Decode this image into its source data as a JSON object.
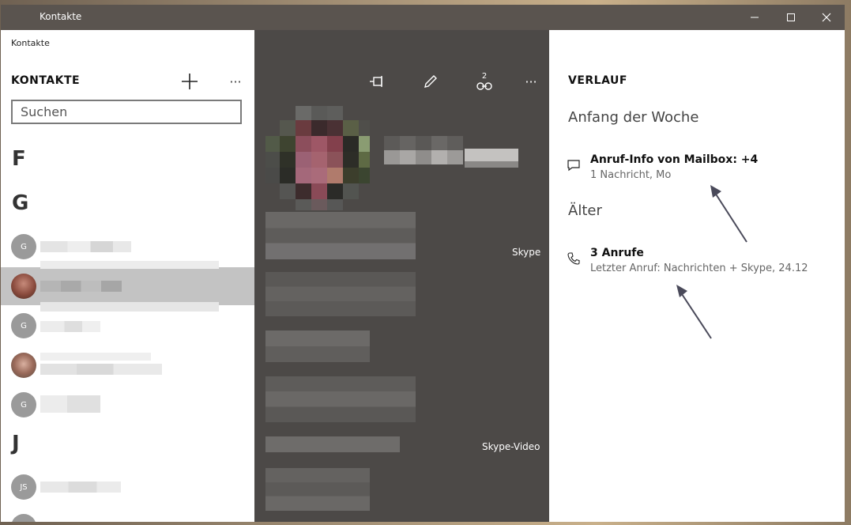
{
  "window": {
    "title": "Kontakte"
  },
  "left": {
    "app_name": "Kontakte",
    "title": "KONTAKTE",
    "add_icon": "plus-icon",
    "more_icon": "ellipsis-icon",
    "more_label": "···",
    "search": {
      "placeholder": "Suchen",
      "value": ""
    },
    "groups": [
      {
        "letter": "F"
      },
      {
        "letter": "G"
      },
      {
        "letter": "J"
      }
    ],
    "contacts": [
      {
        "initials": "G",
        "photo": false
      },
      {
        "initials": "",
        "photo": true,
        "selected": true
      },
      {
        "initials": "G",
        "photo": false
      },
      {
        "initials": "",
        "photo": true
      },
      {
        "initials": "G",
        "photo": false
      },
      {
        "initials": "JS",
        "photo": false
      },
      {
        "initials": "",
        "photo": false
      }
    ]
  },
  "middle": {
    "toolbar": {
      "pin_icon": "pin-icon",
      "edit_icon": "pencil-icon",
      "link_icon": "link-icon",
      "link_count": "2",
      "more_label": "···"
    },
    "labels": {
      "skype": "Skype",
      "skype_video": "Skype-Video"
    }
  },
  "right": {
    "title": "VERLAUF",
    "sections": [
      {
        "heading": "Anfang der Woche",
        "items": [
          {
            "icon": "message-icon",
            "title": "Anruf-Info von Mailbox: +49",
            "subtitle": "1 Nachricht, Mo"
          }
        ]
      },
      {
        "heading": "Älter",
        "items": [
          {
            "icon": "phone-icon",
            "title": "3 Anrufe",
            "subtitle": "Letzter Anruf: Nachrichten + Skype, 24.12"
          }
        ]
      }
    ]
  },
  "colors": {
    "titlebar": "#5a544f",
    "middle_pane": "#4c4947",
    "selected_row": "#c3c3c3",
    "annotation_arrow": "#4a4a5a"
  }
}
